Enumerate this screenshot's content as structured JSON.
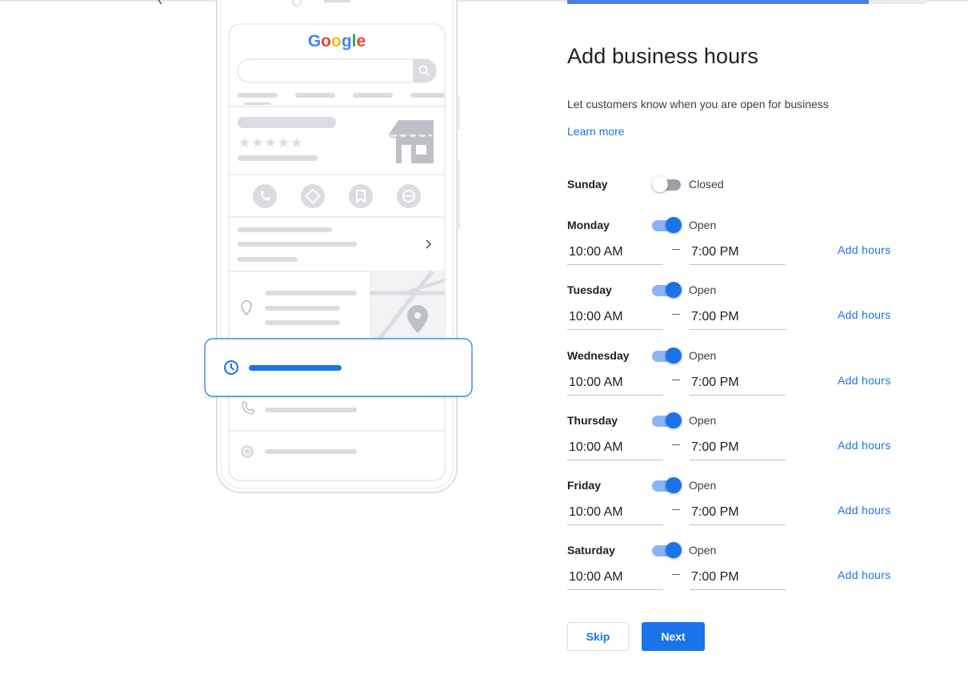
{
  "illustration": {
    "brand_letters": [
      {
        "char": "G",
        "color": "#4285f4"
      },
      {
        "char": "o",
        "color": "#ea4335"
      },
      {
        "char": "o",
        "color": "#fbbc05"
      },
      {
        "char": "g",
        "color": "#4285f4"
      },
      {
        "char": "l",
        "color": "#34a853"
      },
      {
        "char": "e",
        "color": "#ea4335"
      }
    ],
    "rating_stars": "★★★★★",
    "icons": [
      "search-icon",
      "storefront-icon",
      "phone-icon",
      "directions-icon",
      "bookmark-icon",
      "web-icon",
      "chevron-right-icon",
      "location-pin-icon",
      "clock-icon",
      "globe-icon"
    ]
  },
  "form": {
    "progress_fraction": 0.84,
    "title": "Add business hours",
    "subtitle": "Let customers know when you are open for business",
    "learn_more": "Learn more",
    "days": [
      {
        "name": "Sunday",
        "open": false,
        "status": "Closed"
      },
      {
        "name": "Monday",
        "open": true,
        "status": "Open",
        "from": "10:00 AM",
        "to": "7:00 PM",
        "add_hours": "Add hours"
      },
      {
        "name": "Tuesday",
        "open": true,
        "status": "Open",
        "from": "10:00 AM",
        "to": "7:00 PM",
        "add_hours": "Add hours"
      },
      {
        "name": "Wednesday",
        "open": true,
        "status": "Open",
        "from": "10:00 AM",
        "to": "7:00 PM",
        "add_hours": "Add hours"
      },
      {
        "name": "Thursday",
        "open": true,
        "status": "Open",
        "from": "10:00 AM",
        "to": "7:00 PM",
        "add_hours": "Add hours"
      },
      {
        "name": "Friday",
        "open": true,
        "status": "Open",
        "from": "10:00 AM",
        "to": "7:00 PM",
        "add_hours": "Add hours"
      },
      {
        "name": "Saturday",
        "open": true,
        "status": "Open",
        "from": "10:00 AM",
        "to": "7:00 PM",
        "add_hours": "Add hours"
      }
    ],
    "skip_label": "Skip",
    "next_label": "Next"
  },
  "colors": {
    "accent": "#1a73e8",
    "toggle_track_on": "#8ab4f8",
    "toggle_track_off": "#9aa0a6",
    "placeholder_gray": "#dadce0"
  }
}
